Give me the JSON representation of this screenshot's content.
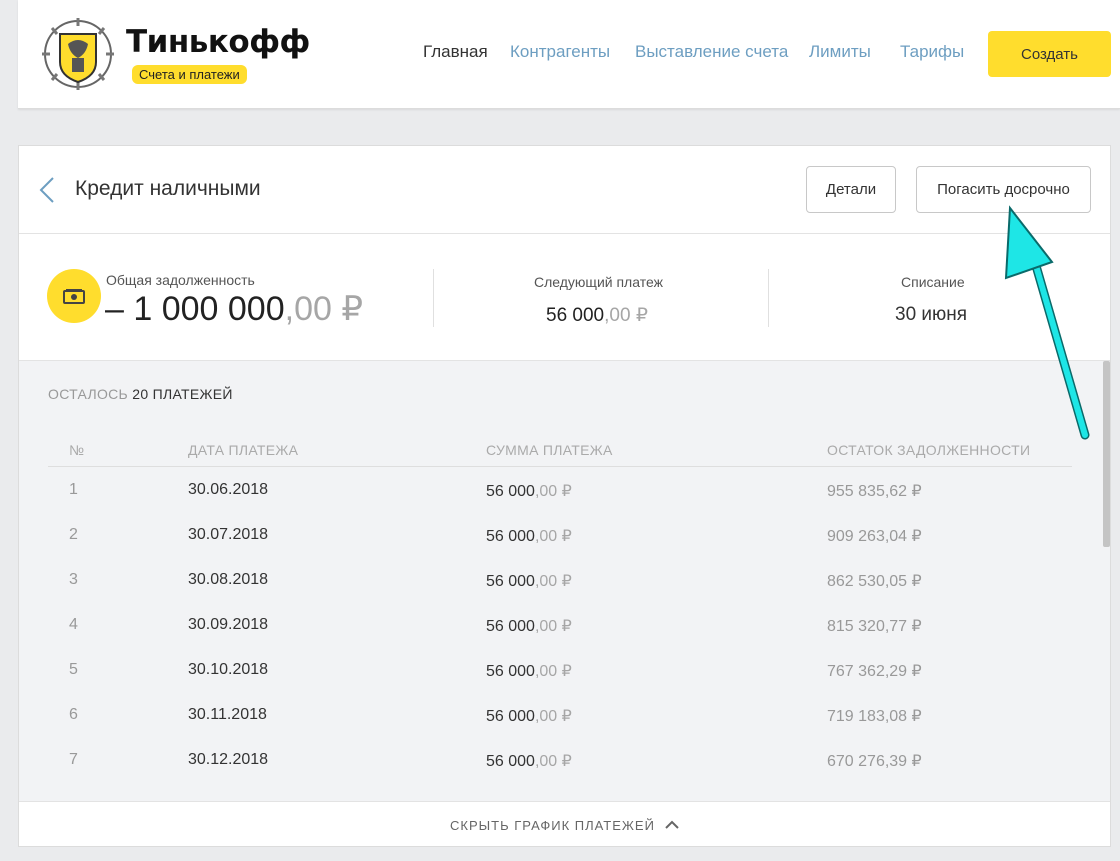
{
  "header": {
    "brand": "Тинькофф",
    "brand_sub": "Счета и платежи",
    "nav": [
      {
        "label": "Главная",
        "active": true
      },
      {
        "label": "Контрагенты",
        "active": false
      },
      {
        "label": "Выставление счета",
        "active": false
      },
      {
        "label": "Лимиты",
        "active": false
      },
      {
        "label": "Тарифы",
        "active": false
      }
    ],
    "create_label": "Создать"
  },
  "card": {
    "title": "Кредит наличными",
    "details_label": "Детали",
    "repay_label": "Погасить досрочно"
  },
  "summary": {
    "total_label": "Общая задолженность",
    "total_main": "– 1 000 000",
    "total_cents": ",00 ₽",
    "next_label": "Следующий платеж",
    "next_main": "56 000",
    "next_cents": ",00 ₽",
    "debit_label": "Списание",
    "debit_date": "30 июня"
  },
  "schedule": {
    "remaining_prefix": "ОСТАЛОСЬ",
    "remaining_count": "20 ПЛАТЕЖЕЙ",
    "columns": [
      "№",
      "ДАТА ПЛАТЕЖА",
      "СУММА ПЛАТЕЖА",
      "ОСТАТОК ЗАДОЛЖЕННОСТИ"
    ],
    "rows": [
      {
        "n": "1",
        "date": "30.06.2018",
        "sum_main": "56 000",
        "sum_cents": ",00 ₽",
        "balance": "955 835,62 ₽"
      },
      {
        "n": "2",
        "date": "30.07.2018",
        "sum_main": "56 000",
        "sum_cents": ",00 ₽",
        "balance": "909 263,04 ₽"
      },
      {
        "n": "3",
        "date": "30.08.2018",
        "sum_main": "56 000",
        "sum_cents": ",00 ₽",
        "balance": "862 530,05 ₽"
      },
      {
        "n": "4",
        "date": "30.09.2018",
        "sum_main": "56 000",
        "sum_cents": ",00 ₽",
        "balance": "815 320,77 ₽"
      },
      {
        "n": "5",
        "date": "30.10.2018",
        "sum_main": "56 000",
        "sum_cents": ",00 ₽",
        "balance": "767 362,29 ₽"
      },
      {
        "n": "6",
        "date": "30.11.2018",
        "sum_main": "56 000",
        "sum_cents": ",00 ₽",
        "balance": "719 183,08 ₽"
      },
      {
        "n": "7",
        "date": "30.12.2018",
        "sum_main": "56 000",
        "sum_cents": ",00 ₽",
        "balance": "670 276,39 ₽"
      }
    ],
    "hide_label": "СКРЫТЬ ГРАФИК ПЛАТЕЖЕЙ"
  },
  "colors": {
    "brand_yellow": "#ffdd2d",
    "link_blue": "#6d9ec1",
    "annotation_cyan": "#1ee6e6"
  },
  "icons": [
    "emblem-logo",
    "chevron-left-icon",
    "cash-icon",
    "chevron-up-icon",
    "annotation-arrow"
  ]
}
